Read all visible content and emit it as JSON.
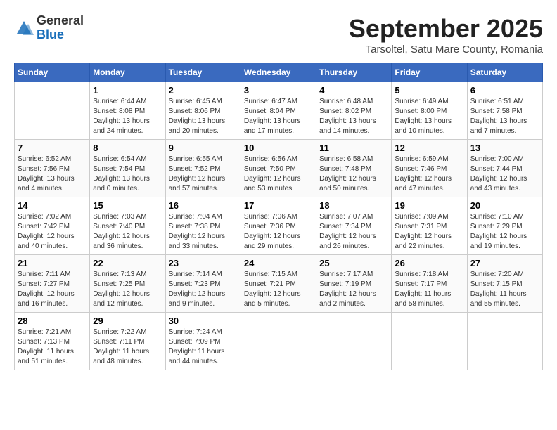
{
  "header": {
    "logo_general": "General",
    "logo_blue": "Blue",
    "month_title": "September 2025",
    "location": "Tarsoltel, Satu Mare County, Romania"
  },
  "days_of_week": [
    "Sunday",
    "Monday",
    "Tuesday",
    "Wednesday",
    "Thursday",
    "Friday",
    "Saturday"
  ],
  "weeks": [
    [
      {
        "day": "",
        "sunrise": "",
        "sunset": "",
        "daylight": ""
      },
      {
        "day": "1",
        "sunrise": "Sunrise: 6:44 AM",
        "sunset": "Sunset: 8:08 PM",
        "daylight": "Daylight: 13 hours and 24 minutes."
      },
      {
        "day": "2",
        "sunrise": "Sunrise: 6:45 AM",
        "sunset": "Sunset: 8:06 PM",
        "daylight": "Daylight: 13 hours and 20 minutes."
      },
      {
        "day": "3",
        "sunrise": "Sunrise: 6:47 AM",
        "sunset": "Sunset: 8:04 PM",
        "daylight": "Daylight: 13 hours and 17 minutes."
      },
      {
        "day": "4",
        "sunrise": "Sunrise: 6:48 AM",
        "sunset": "Sunset: 8:02 PM",
        "daylight": "Daylight: 13 hours and 14 minutes."
      },
      {
        "day": "5",
        "sunrise": "Sunrise: 6:49 AM",
        "sunset": "Sunset: 8:00 PM",
        "daylight": "Daylight: 13 hours and 10 minutes."
      },
      {
        "day": "6",
        "sunrise": "Sunrise: 6:51 AM",
        "sunset": "Sunset: 7:58 PM",
        "daylight": "Daylight: 13 hours and 7 minutes."
      }
    ],
    [
      {
        "day": "7",
        "sunrise": "Sunrise: 6:52 AM",
        "sunset": "Sunset: 7:56 PM",
        "daylight": "Daylight: 13 hours and 4 minutes."
      },
      {
        "day": "8",
        "sunrise": "Sunrise: 6:54 AM",
        "sunset": "Sunset: 7:54 PM",
        "daylight": "Daylight: 13 hours and 0 minutes."
      },
      {
        "day": "9",
        "sunrise": "Sunrise: 6:55 AM",
        "sunset": "Sunset: 7:52 PM",
        "daylight": "Daylight: 12 hours and 57 minutes."
      },
      {
        "day": "10",
        "sunrise": "Sunrise: 6:56 AM",
        "sunset": "Sunset: 7:50 PM",
        "daylight": "Daylight: 12 hours and 53 minutes."
      },
      {
        "day": "11",
        "sunrise": "Sunrise: 6:58 AM",
        "sunset": "Sunset: 7:48 PM",
        "daylight": "Daylight: 12 hours and 50 minutes."
      },
      {
        "day": "12",
        "sunrise": "Sunrise: 6:59 AM",
        "sunset": "Sunset: 7:46 PM",
        "daylight": "Daylight: 12 hours and 47 minutes."
      },
      {
        "day": "13",
        "sunrise": "Sunrise: 7:00 AM",
        "sunset": "Sunset: 7:44 PM",
        "daylight": "Daylight: 12 hours and 43 minutes."
      }
    ],
    [
      {
        "day": "14",
        "sunrise": "Sunrise: 7:02 AM",
        "sunset": "Sunset: 7:42 PM",
        "daylight": "Daylight: 12 hours and 40 minutes."
      },
      {
        "day": "15",
        "sunrise": "Sunrise: 7:03 AM",
        "sunset": "Sunset: 7:40 PM",
        "daylight": "Daylight: 12 hours and 36 minutes."
      },
      {
        "day": "16",
        "sunrise": "Sunrise: 7:04 AM",
        "sunset": "Sunset: 7:38 PM",
        "daylight": "Daylight: 12 hours and 33 minutes."
      },
      {
        "day": "17",
        "sunrise": "Sunrise: 7:06 AM",
        "sunset": "Sunset: 7:36 PM",
        "daylight": "Daylight: 12 hours and 29 minutes."
      },
      {
        "day": "18",
        "sunrise": "Sunrise: 7:07 AM",
        "sunset": "Sunset: 7:34 PM",
        "daylight": "Daylight: 12 hours and 26 minutes."
      },
      {
        "day": "19",
        "sunrise": "Sunrise: 7:09 AM",
        "sunset": "Sunset: 7:31 PM",
        "daylight": "Daylight: 12 hours and 22 minutes."
      },
      {
        "day": "20",
        "sunrise": "Sunrise: 7:10 AM",
        "sunset": "Sunset: 7:29 PM",
        "daylight": "Daylight: 12 hours and 19 minutes."
      }
    ],
    [
      {
        "day": "21",
        "sunrise": "Sunrise: 7:11 AM",
        "sunset": "Sunset: 7:27 PM",
        "daylight": "Daylight: 12 hours and 16 minutes."
      },
      {
        "day": "22",
        "sunrise": "Sunrise: 7:13 AM",
        "sunset": "Sunset: 7:25 PM",
        "daylight": "Daylight: 12 hours and 12 minutes."
      },
      {
        "day": "23",
        "sunrise": "Sunrise: 7:14 AM",
        "sunset": "Sunset: 7:23 PM",
        "daylight": "Daylight: 12 hours and 9 minutes."
      },
      {
        "day": "24",
        "sunrise": "Sunrise: 7:15 AM",
        "sunset": "Sunset: 7:21 PM",
        "daylight": "Daylight: 12 hours and 5 minutes."
      },
      {
        "day": "25",
        "sunrise": "Sunrise: 7:17 AM",
        "sunset": "Sunset: 7:19 PM",
        "daylight": "Daylight: 12 hours and 2 minutes."
      },
      {
        "day": "26",
        "sunrise": "Sunrise: 7:18 AM",
        "sunset": "Sunset: 7:17 PM",
        "daylight": "Daylight: 11 hours and 58 minutes."
      },
      {
        "day": "27",
        "sunrise": "Sunrise: 7:20 AM",
        "sunset": "Sunset: 7:15 PM",
        "daylight": "Daylight: 11 hours and 55 minutes."
      }
    ],
    [
      {
        "day": "28",
        "sunrise": "Sunrise: 7:21 AM",
        "sunset": "Sunset: 7:13 PM",
        "daylight": "Daylight: 11 hours and 51 minutes."
      },
      {
        "day": "29",
        "sunrise": "Sunrise: 7:22 AM",
        "sunset": "Sunset: 7:11 PM",
        "daylight": "Daylight: 11 hours and 48 minutes."
      },
      {
        "day": "30",
        "sunrise": "Sunrise: 7:24 AM",
        "sunset": "Sunset: 7:09 PM",
        "daylight": "Daylight: 11 hours and 44 minutes."
      },
      {
        "day": "",
        "sunrise": "",
        "sunset": "",
        "daylight": ""
      },
      {
        "day": "",
        "sunrise": "",
        "sunset": "",
        "daylight": ""
      },
      {
        "day": "",
        "sunrise": "",
        "sunset": "",
        "daylight": ""
      },
      {
        "day": "",
        "sunrise": "",
        "sunset": "",
        "daylight": ""
      }
    ]
  ]
}
